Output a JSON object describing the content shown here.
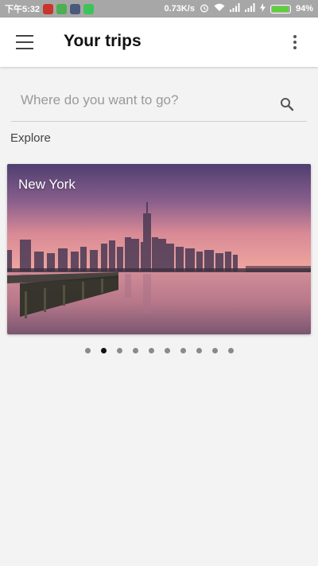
{
  "status_bar": {
    "time": "下午5:32",
    "network_speed": "0.73K/s",
    "battery_percent": "94%",
    "battery_level": 0.94
  },
  "app_bar": {
    "title": "Your trips",
    "menu_icon": "hamburger-menu-icon",
    "overflow_icon": "more-vert-icon"
  },
  "search": {
    "placeholder": "Where do you want to go?",
    "value": "",
    "icon": "search-icon"
  },
  "explore": {
    "label": "Explore"
  },
  "carousel": {
    "cards": [
      {
        "title": "New York"
      }
    ],
    "page_count": 10,
    "active_index": 1
  },
  "colors": {
    "status_bar": "#a7a7a7",
    "app_bar": "#ffffff",
    "background": "#f3f3f3",
    "dot_inactive": "#8a8a8a",
    "dot_active": "#111111"
  }
}
